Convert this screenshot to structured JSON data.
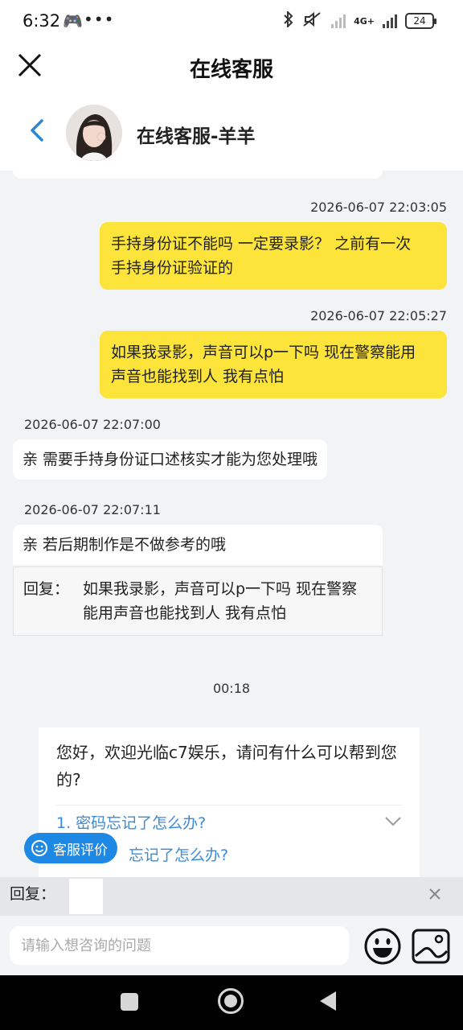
{
  "status_bar": {
    "time": "6:32",
    "dots": "•••",
    "network": "4G+",
    "battery": "24"
  },
  "header": {
    "title": "在线客服"
  },
  "agent": {
    "name": "在线客服-羊羊"
  },
  "messages": [
    {
      "timestamp": "2026-06-07 22:03:05",
      "direction": "out",
      "text": "手持身份证不能吗 一定要录影？ 之前有一次\n手持身份证验证的"
    },
    {
      "timestamp": "2026-06-07 22:05:27",
      "direction": "out",
      "text": "如果我录影，声音可以p一下吗 现在警察能用\n声音也能找到人 我有点怕"
    },
    {
      "timestamp": "2026-06-07 22:07:00",
      "direction": "in",
      "text": "亲 需要手持身份证口述核实才能为您处理哦"
    },
    {
      "timestamp": "2026-06-07 22:07:11",
      "direction": "in",
      "text": "亲 若后期制作是不做参考的哦",
      "quote_label": "回复：",
      "quote_text": "如果我录影，声音可以p一下吗 现在警察能用声音也能找到人 我有点怕"
    }
  ],
  "center_time": "00:18",
  "welcome": {
    "text": "您好，欢迎光临c7娱乐，请问有什么可以帮到您的?",
    "faq": [
      "1. 密码忘记了怎么办?",
      "忘记了怎么办?"
    ]
  },
  "rate_button": "客服评价",
  "reply": {
    "label": "回复："
  },
  "input": {
    "placeholder": "请输入想咨询的问题"
  },
  "colors": {
    "outgoing_bubble": "#fce43a",
    "link": "#3b8ad9",
    "rate_button": "#1e88e5"
  }
}
